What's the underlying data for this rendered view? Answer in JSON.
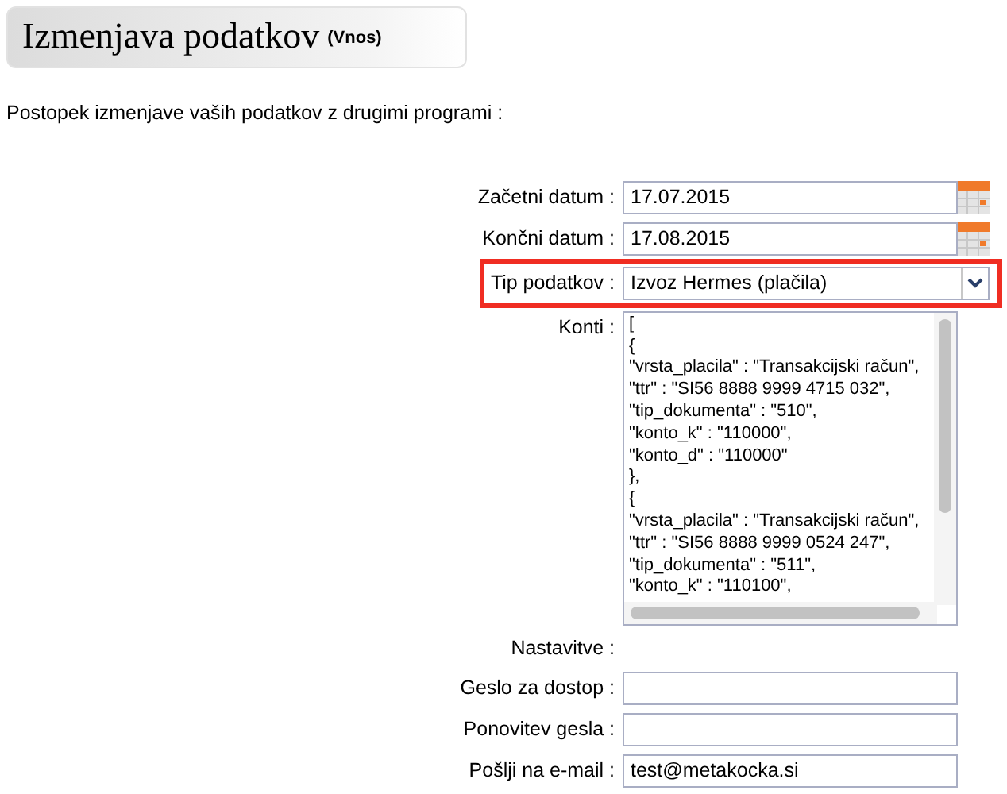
{
  "header": {
    "title": "Izmenjava podatkov",
    "subtitle": "(Vnos)"
  },
  "intro": "Postopek izmenjave vaših podatkov z drugimi programi :",
  "fields": [
    {
      "kind": "date",
      "label": "Začetni datum :",
      "value": "17.07.2015"
    },
    {
      "kind": "date",
      "label": "Končni datum :",
      "value": "17.08.2015"
    },
    {
      "kind": "select",
      "label": "Tip podatkov :",
      "value": "Izvoz Hermes (plačila)",
      "highlighted": true
    },
    {
      "kind": "textarea",
      "label": "Konti :",
      "lines": [
        "[",
        "{",
        "\"vrsta_placila\" : \"Transakcijski račun\",",
        "\"ttr\" : \"SI56 8888 9999 4715 032\",",
        "\"tip_dokumenta\" : \"510\",",
        "\"konto_k\" : \"110000\",",
        "\"konto_d\" : \"110000\"",
        "},",
        "{",
        "\"vrsta_placila\" : \"Transakcijski račun\",",
        "\"ttr\" : \"SI56 8888 9999 0524 247\",",
        "\"tip_dokumenta\" : \"511\",",
        "\"konto_k\" : \"110100\","
      ]
    },
    {
      "kind": "heading",
      "label": "Nastavitve :"
    },
    {
      "kind": "text",
      "label": "Geslo za dostop :"
    },
    {
      "kind": "text",
      "label": "Ponovitev gesla :"
    },
    {
      "kind": "text",
      "label": "Pošlji na e-mail :",
      "value": "test@metakocka.si"
    }
  ]
}
